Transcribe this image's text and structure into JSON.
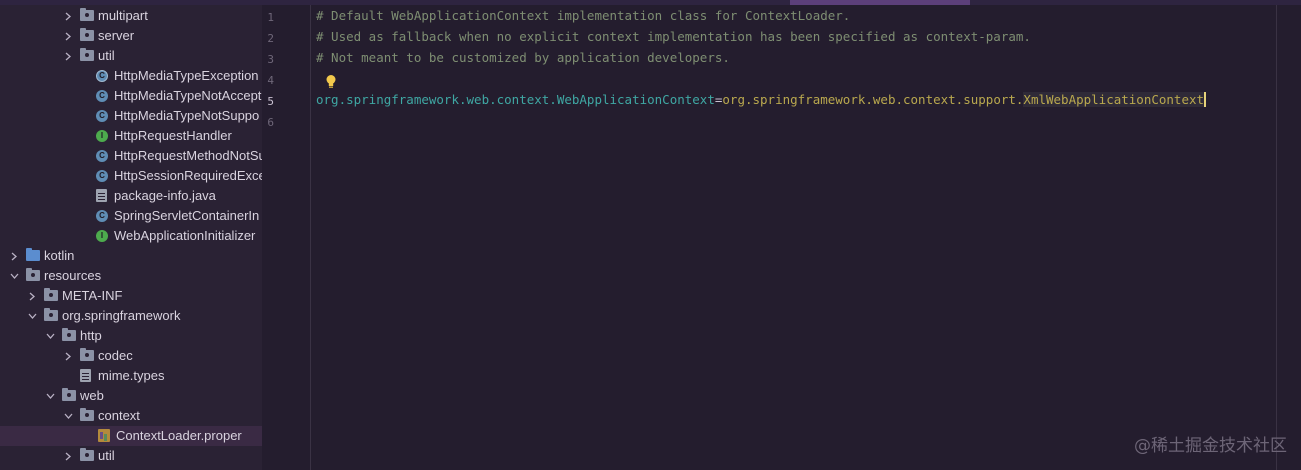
{
  "tree": [
    {
      "label": "multipart",
      "icon": "folder-icon",
      "chevron": "right"
    },
    {
      "label": "server",
      "icon": "folder-icon",
      "chevron": "right"
    },
    {
      "label": "util",
      "icon": "folder-icon",
      "chevron": "right"
    },
    {
      "label": "HttpMediaTypeException",
      "icon": "class-exception-icon",
      "chevron": ""
    },
    {
      "label": "HttpMediaTypeNotAccept",
      "icon": "class-icon",
      "chevron": ""
    },
    {
      "label": "HttpMediaTypeNotSuppo",
      "icon": "class-icon",
      "chevron": ""
    },
    {
      "label": "HttpRequestHandler",
      "icon": "interface-icon",
      "chevron": ""
    },
    {
      "label": "HttpRequestMethodNotSu",
      "icon": "class-icon",
      "chevron": ""
    },
    {
      "label": "HttpSessionRequiredExce",
      "icon": "class-icon",
      "chevron": ""
    },
    {
      "label": "package-info.java",
      "icon": "file-icon",
      "chevron": ""
    },
    {
      "label": "SpringServletContainerIn",
      "icon": "class-icon",
      "chevron": ""
    },
    {
      "label": "WebApplicationInitializer",
      "icon": "interface-icon",
      "chevron": ""
    },
    {
      "label": "kotlin",
      "icon": "source-folder-icon",
      "chevron": "right"
    },
    {
      "label": "resources",
      "icon": "resources-folder-icon",
      "chevron": "down"
    },
    {
      "label": "META-INF",
      "icon": "folder-icon",
      "chevron": "right"
    },
    {
      "label": "org.springframework",
      "icon": "folder-icon",
      "chevron": "down"
    },
    {
      "label": "http",
      "icon": "folder-icon",
      "chevron": "down"
    },
    {
      "label": "codec",
      "icon": "folder-icon",
      "chevron": "right"
    },
    {
      "label": "mime.types",
      "icon": "file-icon",
      "chevron": ""
    },
    {
      "label": "web",
      "icon": "folder-icon",
      "chevron": "down"
    },
    {
      "label": "context",
      "icon": "folder-icon",
      "chevron": "down"
    },
    {
      "label": "ContextLoader.proper",
      "icon": "properties-file-icon",
      "chevron": ""
    },
    {
      "label": "util",
      "icon": "folder-icon",
      "chevron": "right"
    }
  ],
  "editor": {
    "line_numbers": [
      "1",
      "2",
      "3",
      "4",
      "5",
      "6"
    ],
    "current_line": "5",
    "comments": [
      "# Default WebApplicationContext implementation class for ContextLoader.",
      "# Used as fallback when no explicit context implementation has been specified as context-param.",
      "# Not meant to be customized by application developers."
    ],
    "prop_key": "org.springframework.web.context.WebApplicationContext",
    "prop_eq": "=",
    "prop_value_prefix": "org.springframework.web.context.support.",
    "prop_value_class": "XmlWebApplicationContext"
  },
  "watermark": "@稀土掘金技术社区",
  "colors": {
    "background": "#241d2e",
    "sidebar": "#2a2234",
    "comment": "#7e8e72",
    "key": "#3fa7a3",
    "value": "#b9a84e"
  }
}
